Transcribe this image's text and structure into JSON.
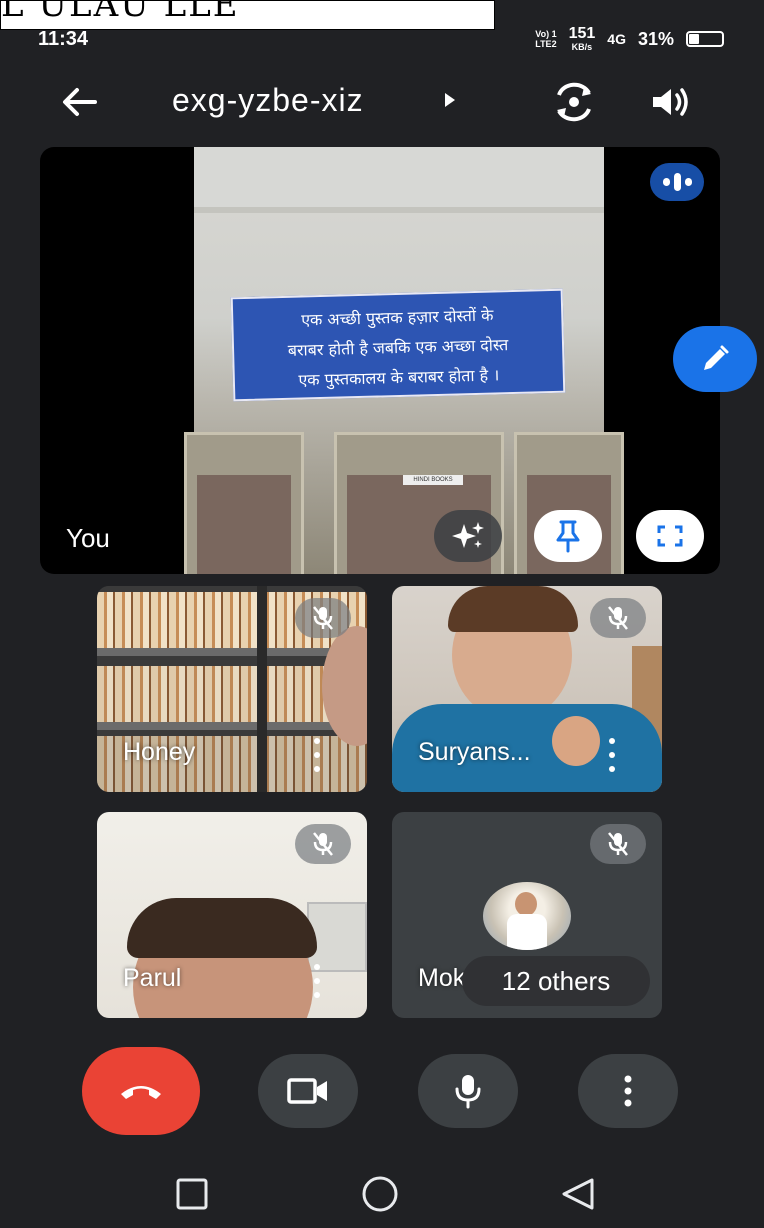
{
  "overlay": {
    "text": "L ULAU LLE"
  },
  "status_bar": {
    "time": "11:34",
    "network_small_top": "Vo) 1",
    "network_small_bottom": "LTE2",
    "speed_value": "151",
    "speed_unit": "KB/s",
    "signal": "4G",
    "battery_percent": "31%"
  },
  "header": {
    "back_icon": "arrow-left-icon",
    "meeting_code": "exg-yzbe-xiz",
    "switch_camera_icon": "camera-flip-icon",
    "speaker_icon": "volume-icon"
  },
  "self_tile": {
    "label": "You",
    "banner_lines": [
      "एक अच्छी पुस्तक हज़ार दोस्तों के",
      "बराबर होती है जबकि एक अच्छा दोस्त",
      "एक पुस्तकालय के बराबर होता है ।"
    ],
    "cupboard_label": "HINDI BOOKS",
    "speaking": true
  },
  "participants": [
    {
      "name": "Honey",
      "muted": true
    },
    {
      "name": "Suryans...",
      "muted": true
    },
    {
      "name": "Parul",
      "muted": true
    },
    {
      "name": "Mok",
      "muted": true,
      "others_label": "12 others"
    }
  ],
  "controls": {
    "end_call_icon": "phone-hangup-icon",
    "camera_icon": "video-camera-icon",
    "mic_icon": "microphone-icon",
    "more_icon": "more-vertical-icon"
  },
  "colors": {
    "end_call": "#ea4335",
    "accent_blue": "#1a73e8",
    "speaking_badge": "#174ea6",
    "control_bg": "#3c4043"
  }
}
